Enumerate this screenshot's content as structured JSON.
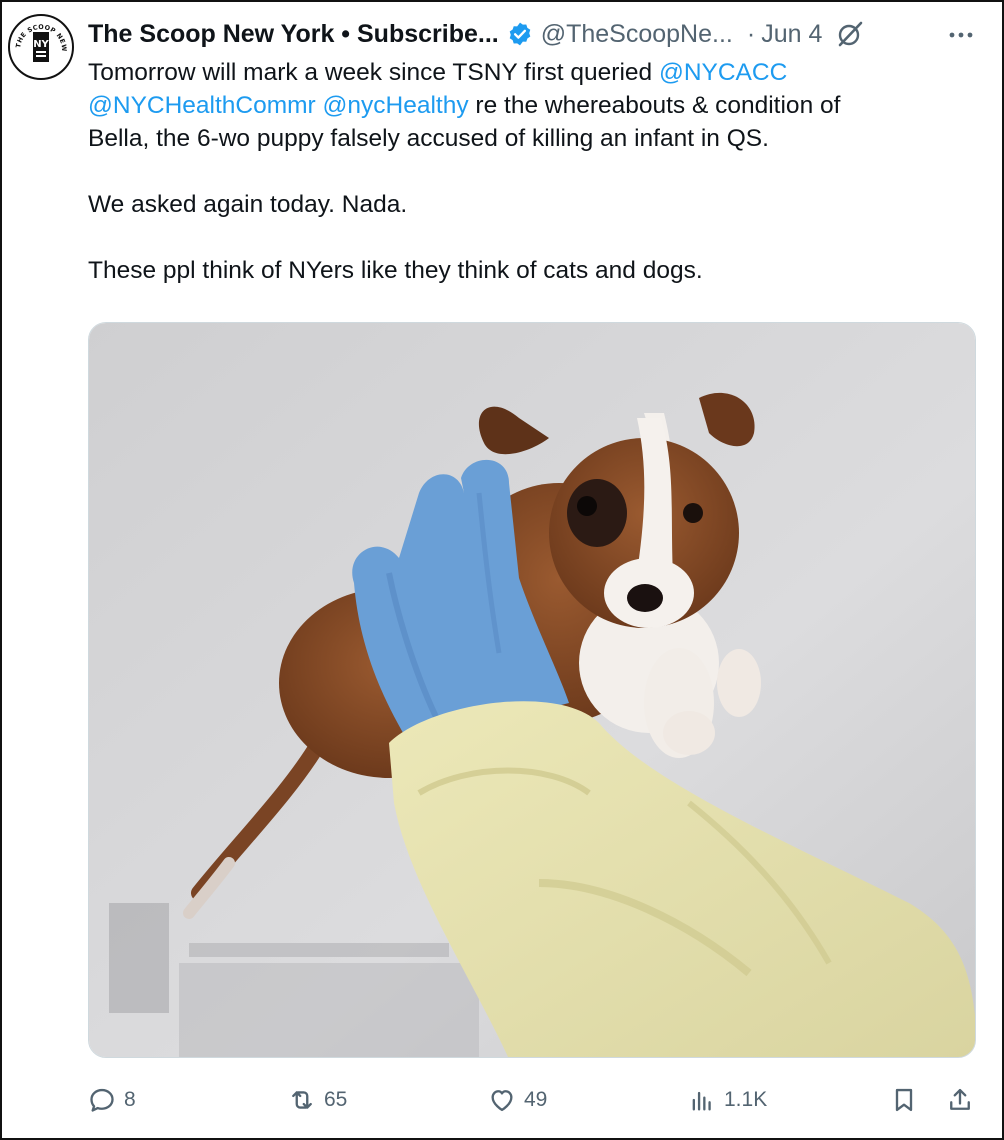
{
  "tweet": {
    "display_name": "The Scoop New York • Subscribe...",
    "handle": "@TheScoopNe...",
    "separator": "·",
    "date": "Jun 4",
    "body_line1_prefix": "Tomorrow will mark a week since TSNY first queried ",
    "mention_1": "@NYCACC",
    "mention_2": "@NYCHealthCommr",
    "mention_3": "@nycHealthy",
    "body_line2_suffix": " re the whereabouts & condition of",
    "body_line3": "Bella, the 6-wo puppy falsely accused of killing an infant in QS.",
    "paragraph_2": "We asked again today. Nada.",
    "paragraph_3": "These ppl think of NYers like they think of cats and dogs.",
    "avatar_arc_text": "THE SCOOP NEW YORK",
    "avatar_letters": "NY"
  },
  "metrics": {
    "replies": "8",
    "reposts": "65",
    "likes": "49",
    "views": "1.1K"
  },
  "icons": {
    "verified": "verified-badge-icon",
    "grok": "grok-icon",
    "more": "more-icon",
    "reply": "reply-icon",
    "repost": "repost-icon",
    "like": "heart-icon",
    "views": "views-icon",
    "bookmark": "bookmark-icon",
    "share": "share-icon"
  },
  "colors": {
    "link": "#1d9bf0",
    "text": "#0f1419",
    "secondary": "#536471"
  }
}
